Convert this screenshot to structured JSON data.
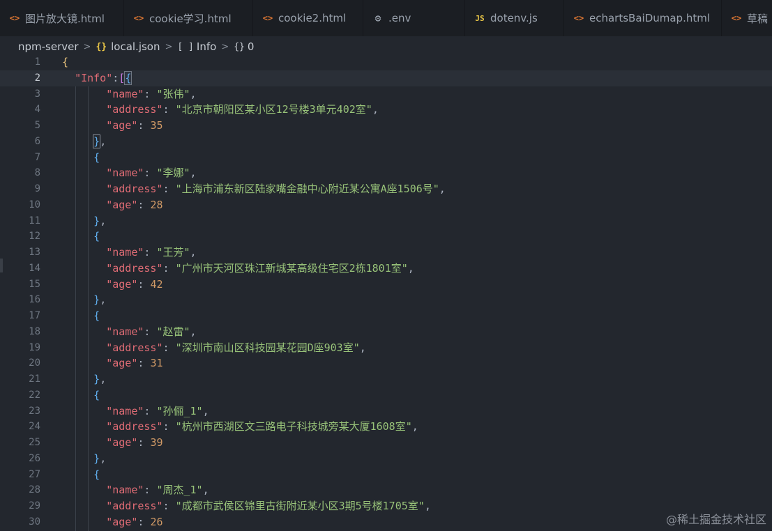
{
  "tabs": [
    {
      "label": "图片放大镜.html",
      "icon": "html-icon"
    },
    {
      "label": "cookie学习.html",
      "icon": "html-icon"
    },
    {
      "label": "cookie2.html",
      "icon": "html-icon"
    },
    {
      "label": ".env",
      "icon": "gear-icon"
    },
    {
      "label": "dotenv.js",
      "icon": "js-icon"
    },
    {
      "label": "echartsBaiDumap.html",
      "icon": "html-icon"
    },
    {
      "label": "草稿",
      "icon": "html-icon"
    }
  ],
  "icon_glyphs": {
    "html": "<>",
    "gear": "⚙",
    "js": "JS"
  },
  "breadcrumb": {
    "folder": "npm-server",
    "file_icon": "{}",
    "file": "local.json",
    "array_icon": "[ ]",
    "array": "Info",
    "object_icon": "{}",
    "object": "0"
  },
  "editor": {
    "current_line": 2,
    "key_info": "\"Info\"",
    "key_name": "\"name\"",
    "key_address": "\"address\"",
    "key_age": "\"age\"",
    "records": [
      {
        "name": "\"张伟\"",
        "address": "\"北京市朝阳区某小区12号楼3单元402室\"",
        "age": "35"
      },
      {
        "name": "\"李娜\"",
        "address": "\"上海市浦东新区陆家嘴金融中心附近某公寓A座1506号\"",
        "age": "28"
      },
      {
        "name": "\"王芳\"",
        "address": "\"广州市天河区珠江新城某高级住宅区2栋1801室\"",
        "age": "42"
      },
      {
        "name": "\"赵雷\"",
        "address": "\"深圳市南山区科技园某花园D座903室\"",
        "age": "31"
      },
      {
        "name": "\"孙俪_1\"",
        "address": "\"杭州市西湖区文三路电子科技城旁某大厦1608室\"",
        "age": "39"
      },
      {
        "name": "\"周杰_1\"",
        "address": "\"成都市武侯区锦里古街附近某小区3期5号楼1705室\"",
        "age": "26"
      }
    ]
  },
  "watermark": "@稀土掘金技术社区",
  "colors": {
    "key": "#e06c75",
    "string": "#98c379",
    "number": "#d19a66",
    "brace_outer": "#e5c07b",
    "bracket": "#c678dd",
    "brace_inner": "#61afef",
    "background": "#23272e"
  }
}
